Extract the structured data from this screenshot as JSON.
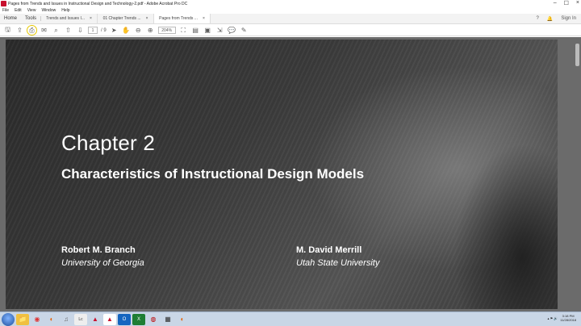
{
  "window": {
    "title": "Pages from Trends and Issues in Instructional Design and Technology-2.pdf - Adobe Acrobat Pro DC"
  },
  "menu": [
    "File",
    "Edit",
    "View",
    "Window",
    "Help"
  ],
  "nav_tabs": [
    {
      "label": "Home"
    },
    {
      "label": "Tools"
    }
  ],
  "doc_tabs": [
    {
      "label": "Trends and Issues I...",
      "close": "×"
    },
    {
      "label": "01 Chapter Trends ...",
      "close": "×"
    },
    {
      "label": "Pages from Trends ...",
      "close": "×"
    }
  ],
  "account": {
    "sign_in": "Sign In",
    "help": "?"
  },
  "toolbar": {
    "page_current": "1",
    "page_total": "/ 9",
    "zoom": "204%"
  },
  "document": {
    "chapter": "Chapter 2",
    "title": "Characteristics of Instructional Design Models",
    "authors": [
      {
        "name": "Robert M. Branch",
        "affiliation": "University of Georgia"
      },
      {
        "name": "M. David Merrill",
        "affiliation": "Utah State University"
      }
    ]
  },
  "taskbar": {
    "apps": [
      "windows-explorer",
      "chrome",
      "firefox",
      "itunes",
      "lc",
      "acrobat",
      "acrobat-2",
      "outlook",
      "excel",
      "camtasia",
      "calculator",
      "firefox-2"
    ],
    "clock_time": "3:18 PM",
    "clock_date": "11/28/2018"
  },
  "colors": {
    "accent": "#c8102e",
    "taskbar": "#c9d6e6",
    "highlight": "#e6c800"
  }
}
